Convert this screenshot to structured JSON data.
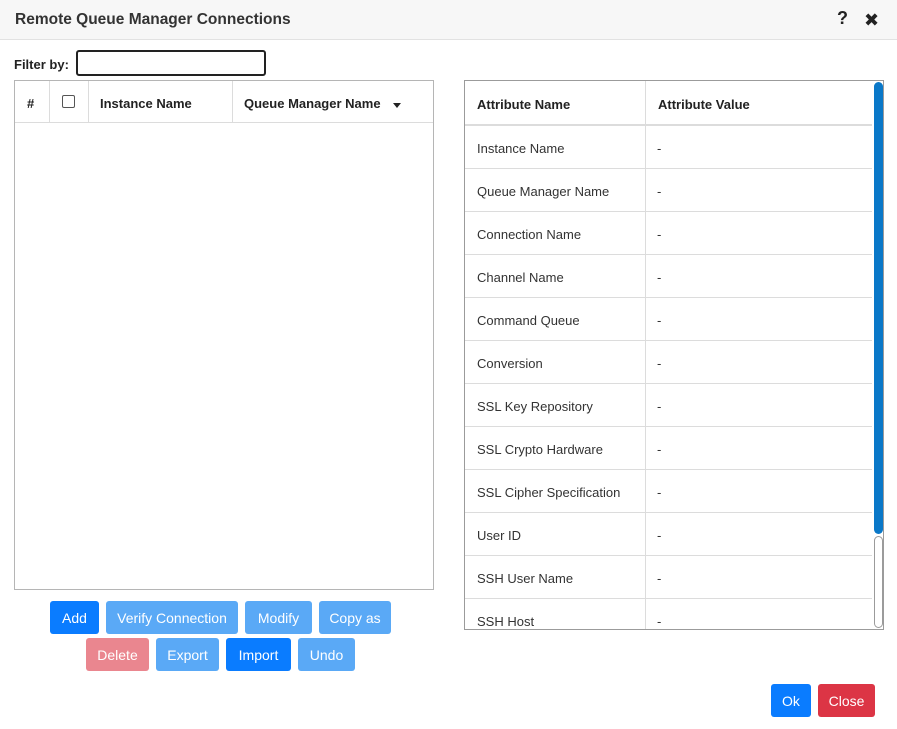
{
  "dialog": {
    "title": "Remote Queue Manager Connections",
    "help_glyph": "?",
    "close_glyph": "✖"
  },
  "filter": {
    "label": "Filter by:",
    "value": ""
  },
  "connections_table": {
    "columns": [
      "#",
      "",
      "Instance Name",
      "Queue Manager Name"
    ],
    "rows": []
  },
  "actions": {
    "add": "Add",
    "verify": "Verify Connection",
    "modify": "Modify",
    "copy_as": "Copy as",
    "delete": "Delete",
    "export": "Export",
    "import": "Import",
    "undo": "Undo"
  },
  "attributes_table": {
    "headers": [
      "Attribute Name",
      "Attribute Value"
    ],
    "rows": [
      {
        "name": "Instance Name",
        "value": "-"
      },
      {
        "name": "Queue Manager Name",
        "value": "-"
      },
      {
        "name": "Connection Name",
        "value": "-"
      },
      {
        "name": "Channel Name",
        "value": "-"
      },
      {
        "name": "Command Queue",
        "value": "-"
      },
      {
        "name": "Conversion",
        "value": "-"
      },
      {
        "name": "SSL Key Repository",
        "value": "-"
      },
      {
        "name": "SSL Crypto Hardware",
        "value": "-"
      },
      {
        "name": "SSL Cipher Specification",
        "value": "-"
      },
      {
        "name": "User ID",
        "value": "-"
      },
      {
        "name": "SSH User Name",
        "value": "-"
      },
      {
        "name": "SSH Host",
        "value": "-"
      }
    ]
  },
  "footer": {
    "ok": "Ok",
    "close": "Close"
  },
  "colors": {
    "primary": "#0a7cff",
    "primary_disabled": "#5aa9f6",
    "danger": "#dc3545",
    "danger_disabled": "#ea868f",
    "scroll_thumb": "#0a78c8"
  }
}
